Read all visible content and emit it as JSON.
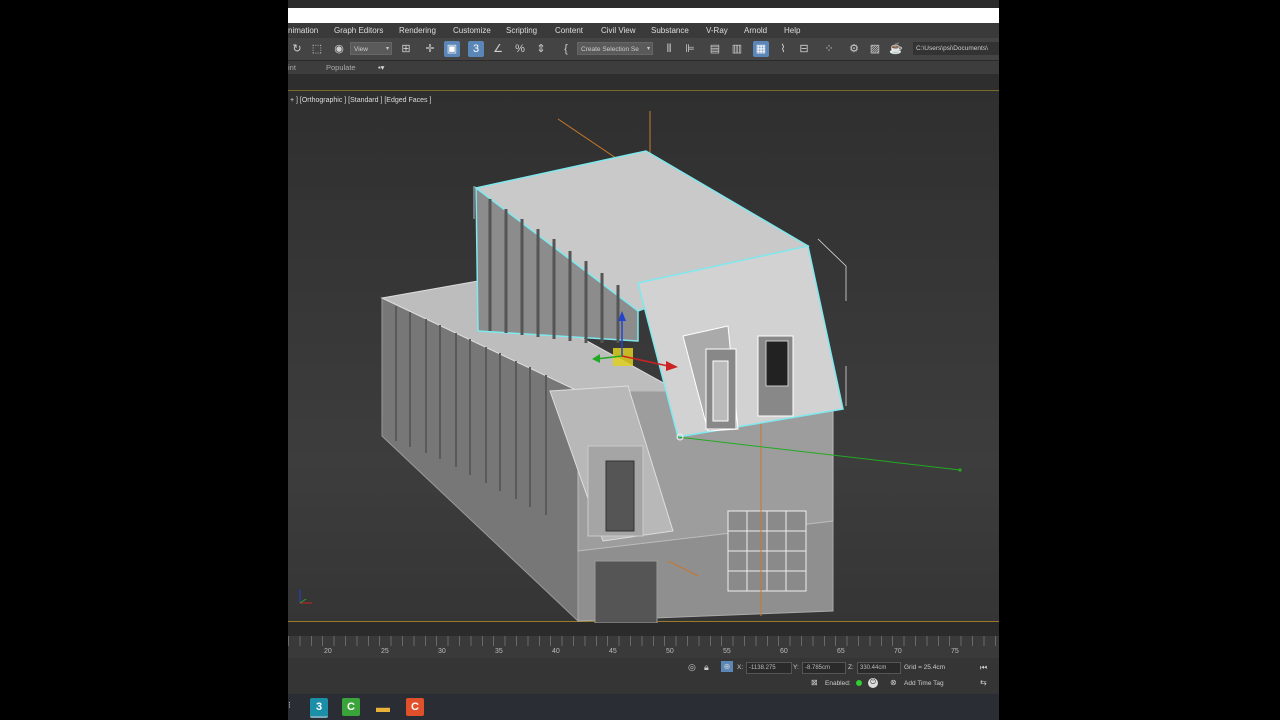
{
  "menu": {
    "items": [
      "nimation",
      "Graph Editors",
      "Rendering",
      "Customize",
      "Scripting",
      "Content",
      "Civil View",
      "Substance",
      "V-Ray",
      "Arnold",
      "Help"
    ]
  },
  "toolbar": {
    "view_dropdown": "View",
    "selection_set_dropdown": "Create Selection Se",
    "path": "C:\\Users\\psi\\Documents\\",
    "icons": [
      "redo-icon",
      "select-region-icon",
      "select-object-icon",
      "view-dropdown",
      "select-by-name-icon",
      "move-icon",
      "select-manipulate-icon",
      "snap-3d-icon",
      "angle-snap-icon",
      "percent-snap-icon",
      "spinner-snap-icon",
      "edit-named-selection-icon",
      "selection-set-dropdown",
      "mirror-icon",
      "align-icon",
      "layer-explorer-icon",
      "scene-explorer-icon",
      "toggle-ribbon-icon",
      "curve-editor-icon",
      "schematic-view-icon",
      "material-editor-icon",
      "render-setup-icon",
      "rendered-frame-icon",
      "render-icon"
    ]
  },
  "ribbon": {
    "left_label": "int",
    "populate_label": "Populate"
  },
  "viewport": {
    "label": "+ ] [Orthographic ] [Standard ] [Edged Faces ]"
  },
  "timeline": {
    "ticks": [
      "20",
      "25",
      "30",
      "35",
      "40",
      "45",
      "50",
      "55",
      "60",
      "65",
      "70",
      "75"
    ]
  },
  "status": {
    "x_label": "X:",
    "x_value": "-1138.275",
    "y_label": "Y:",
    "y_value": "-8.785cm",
    "z_label": "Z:",
    "z_value": "330.44cm",
    "grid": "Grid = 25.4cm",
    "enabled_label": "Enabled:",
    "add_time_tag": "Add Time Tag"
  },
  "taskbar": {
    "apps": [
      {
        "name": "3ds-max-icon",
        "glyph": "3",
        "color": "#1c8fa8"
      },
      {
        "name": "camtasia-green-icon",
        "glyph": "C",
        "color": "#3aa33a"
      },
      {
        "name": "file-explorer-icon",
        "glyph": "▬",
        "color": "#e8b23a"
      },
      {
        "name": "camtasia-red-icon",
        "glyph": "C",
        "color": "#e0502a"
      }
    ]
  },
  "colors": {
    "selection": "#7fe8ee",
    "axis_x": "#cc2222",
    "axis_y": "#22aa22",
    "axis_z": "#2244cc",
    "gizmo": "#e0d020",
    "orange_guide": "#c8782a"
  }
}
